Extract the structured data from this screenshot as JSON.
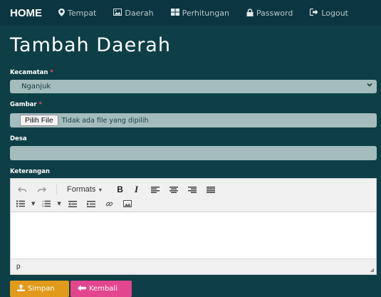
{
  "nav": {
    "brand": "HOME",
    "items": [
      {
        "label": "Tempat",
        "icon": "map-marker-icon",
        "glyph": "⬤"
      },
      {
        "label": "Daerah",
        "icon": "picture-icon",
        "glyph": "▣"
      },
      {
        "label": "Perhitungan",
        "icon": "grid-icon",
        "glyph": "▦"
      },
      {
        "label": "Password",
        "icon": "lock-icon",
        "glyph": "▲"
      },
      {
        "label": "Logout",
        "icon": "logout-icon",
        "glyph": "➜"
      }
    ]
  },
  "page": {
    "title": "Tambah Daerah"
  },
  "form": {
    "kecamatan": {
      "label": "Kecamatan",
      "required_mark": "*",
      "value": "Nganjuk"
    },
    "gambar": {
      "label": "Gambar",
      "required_mark": "*",
      "button": "Pilih File",
      "status": "Tidak ada file yang dipilih"
    },
    "desa": {
      "label": "Desa",
      "value": ""
    },
    "keterangan": {
      "label": "Keterangan"
    }
  },
  "editor": {
    "formats_label": "Formats",
    "bold_label": "B",
    "italic_label": "I",
    "status_path": "p"
  },
  "buttons": {
    "save": "Simpan",
    "back": "Kembali"
  },
  "colors": {
    "background": "#0e3f47",
    "navbar": "#0b3540",
    "input": "#a4bcbd",
    "save": "#e19a1b",
    "back": "#e4458f",
    "required": "#e74c6a"
  }
}
